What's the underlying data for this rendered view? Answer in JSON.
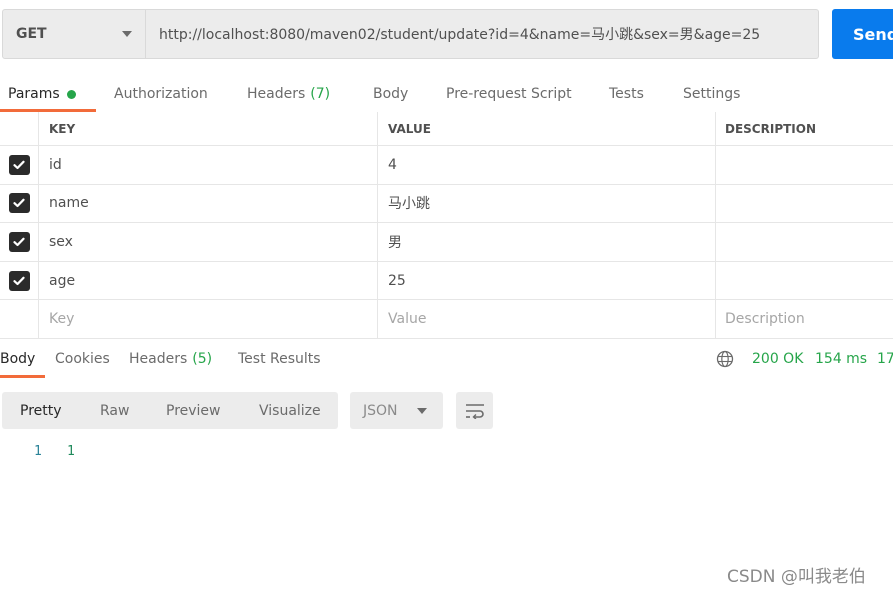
{
  "request": {
    "method": "GET",
    "url": "http://localhost:8080/maven02/student/update?id=4&name=马小跳&sex=男&age=25",
    "send_label": "Send"
  },
  "request_tabs": [
    {
      "label": "Params",
      "active": true,
      "indicator": "dot"
    },
    {
      "label": "Authorization"
    },
    {
      "label": "Headers",
      "count": "(7)"
    },
    {
      "label": "Body"
    },
    {
      "label": "Pre-request Script"
    },
    {
      "label": "Tests"
    },
    {
      "label": "Settings"
    }
  ],
  "params": {
    "headers": {
      "key": "KEY",
      "value": "VALUE",
      "description": "DESCRIPTION"
    },
    "rows": [
      {
        "checked": true,
        "key": "id",
        "value": "4",
        "description": ""
      },
      {
        "checked": true,
        "key": "name",
        "value": "马小跳",
        "description": ""
      },
      {
        "checked": true,
        "key": "sex",
        "value": "男",
        "description": ""
      },
      {
        "checked": true,
        "key": "age",
        "value": "25",
        "description": ""
      }
    ],
    "placeholders": {
      "key": "Key",
      "value": "Value",
      "description": "Description"
    }
  },
  "response_tabs": [
    {
      "label": "Body",
      "active": true
    },
    {
      "label": "Cookies"
    },
    {
      "label": "Headers",
      "count": "(5)"
    },
    {
      "label": "Test Results"
    }
  ],
  "response_status": {
    "status": "200 OK",
    "time": "154 ms",
    "size": "17"
  },
  "body_view": {
    "modes": [
      "Pretty",
      "Raw",
      "Preview",
      "Visualize"
    ],
    "active_mode": "Pretty",
    "language": "JSON"
  },
  "response_body": [
    {
      "line": "1",
      "content": "1"
    }
  ],
  "colors": {
    "accent": "#f26b3a",
    "send": "#097bed",
    "success": "#26a54a"
  },
  "watermark": "CSDN @叫我老伯"
}
